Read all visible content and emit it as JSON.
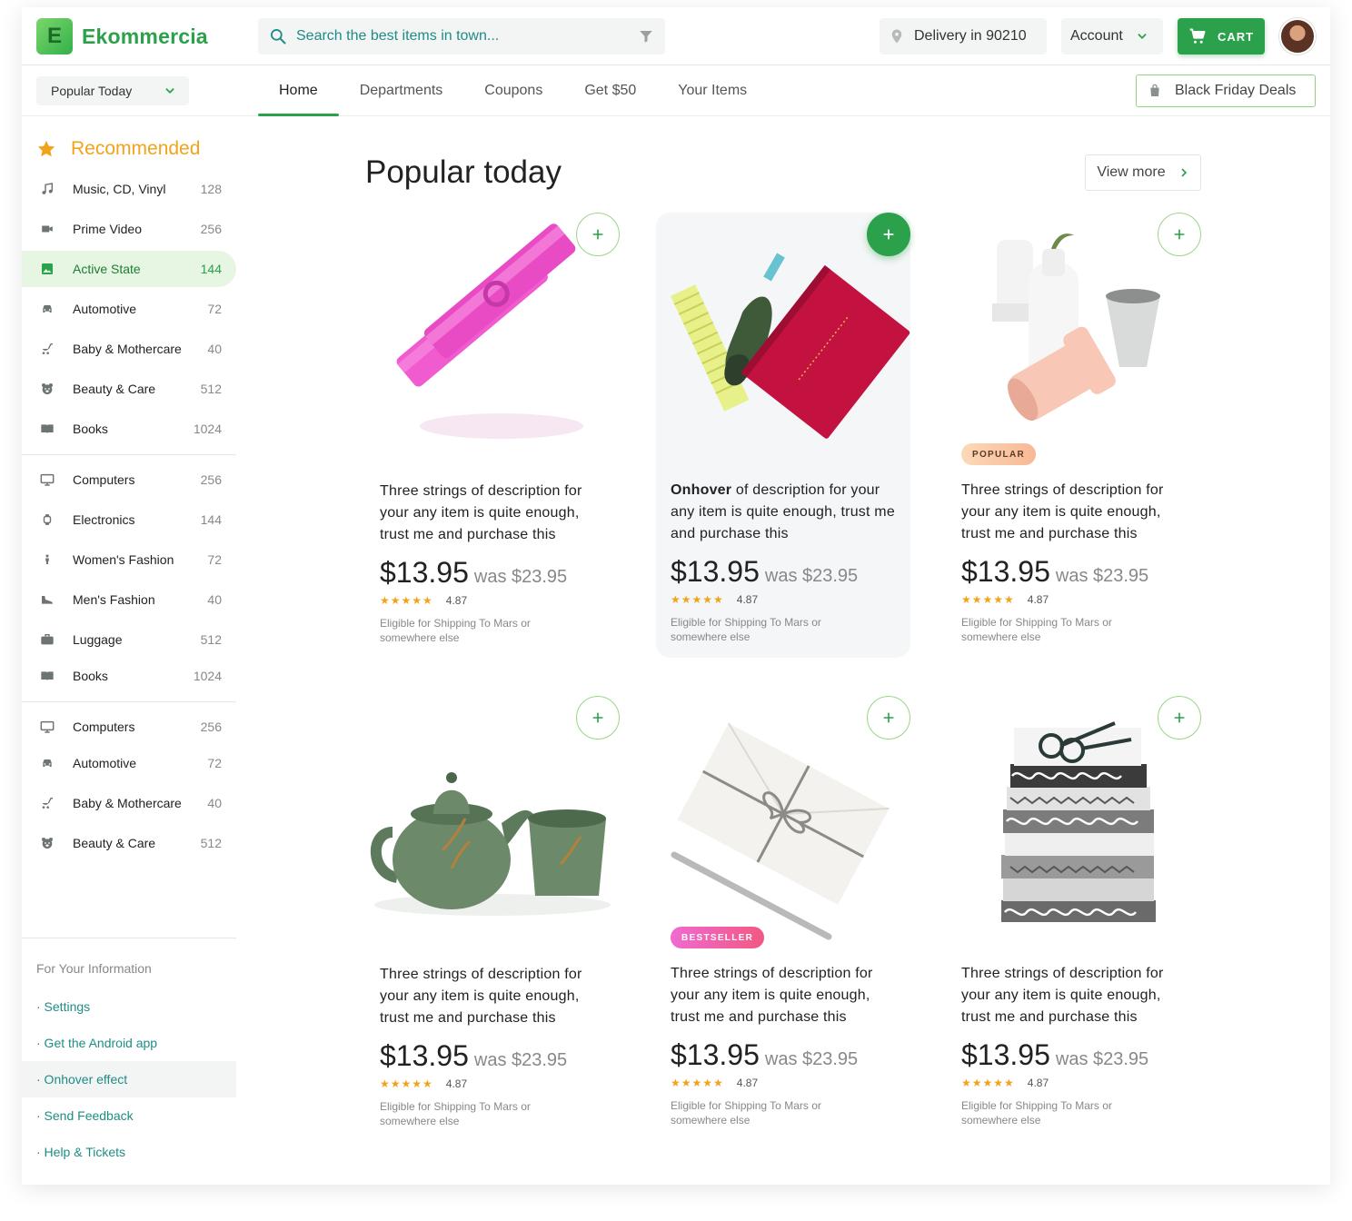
{
  "brand": {
    "initial": "E",
    "name": "Ekommercia"
  },
  "search": {
    "placeholder": "Search the best items in town..."
  },
  "delivery": {
    "label": "Delivery in 90210"
  },
  "account": {
    "label": "Account"
  },
  "cart": {
    "label": "CART"
  },
  "filter_select": {
    "value": "Popular Today"
  },
  "tabs": [
    {
      "label": "Home"
    },
    {
      "label": "Departments"
    },
    {
      "label": "Coupons"
    },
    {
      "label": "Get $50"
    },
    {
      "label": "Your Items"
    }
  ],
  "deals": {
    "label": "Black Friday Deals"
  },
  "sidebar": {
    "recommended_label": "Recommended",
    "categories": [
      {
        "icon": "music-note-icon",
        "label": "Music, CD, Vinyl",
        "count": "128"
      },
      {
        "icon": "video-camera-icon",
        "label": "Prime Video",
        "count": "256"
      },
      {
        "icon": "image-icon",
        "label": "Active State",
        "count": "144"
      },
      {
        "icon": "car-icon",
        "label": "Automotive",
        "count": "72"
      },
      {
        "icon": "stroller-icon",
        "label": "Baby & Mothercare",
        "count": "40"
      },
      {
        "icon": "bear-face-icon",
        "label": "Beauty & Care",
        "count": "512"
      },
      {
        "icon": "book-icon",
        "label": "Books",
        "count": "1024"
      },
      {
        "icon": "monitor-icon",
        "label": "Computers",
        "count": "256"
      },
      {
        "icon": "watch-icon",
        "label": "Electronics",
        "count": "144"
      },
      {
        "icon": "woman-icon",
        "label": "Women's Fashion",
        "count": "72"
      },
      {
        "icon": "shoe-icon",
        "label": "Men's Fashion",
        "count": "40"
      },
      {
        "icon": "briefcase-icon",
        "label": "Luggage",
        "count": "512"
      },
      {
        "icon": "book-icon",
        "label": "Books",
        "count": "1024"
      },
      {
        "icon": "monitor-icon",
        "label": "Computers",
        "count": "256"
      },
      {
        "icon": "car-icon",
        "label": "Automotive",
        "count": "72"
      },
      {
        "icon": "stroller-icon",
        "label": "Baby & Mothercare",
        "count": "40"
      },
      {
        "icon": "bear-face-icon",
        "label": "Beauty & Care",
        "count": "512"
      }
    ],
    "fyi_title": "For Your Information",
    "fyi_links": [
      {
        "label": "· Settings"
      },
      {
        "label": "· Get the Android app"
      },
      {
        "label": "· Onhover effect"
      },
      {
        "label": "· Send Feedback"
      },
      {
        "label": "· Help & Tickets"
      }
    ]
  },
  "main": {
    "title": "Popular today",
    "view_more": "View more",
    "products": [
      {
        "bold": "",
        "desc": "Three strings of description for your any item is quite enough, trust me and purchase this",
        "price": "$13.95",
        "was": "was $23.95",
        "stars": "★★★★★",
        "rating": "4.87",
        "shipping": "Eligible for Shipping To Mars or somewhere else",
        "badge": ""
      },
      {
        "bold": "Onhover",
        "desc": " of description for your any item is quite enough, trust me and purchase this",
        "price": "$13.95",
        "was": "was $23.95",
        "stars": "★★★★★",
        "rating": "4.87",
        "shipping": "Eligible for Shipping To Mars or somewhere else",
        "badge": ""
      },
      {
        "bold": "",
        "desc": "Three strings of description for your any item is quite enough, trust me and purchase this",
        "price": "$13.95",
        "was": "was $23.95",
        "stars": "★★★★★",
        "rating": "4.87",
        "shipping": "Eligible for Shipping To Mars or somewhere else",
        "badge": "POPULAR"
      },
      {
        "bold": "",
        "desc": "Three strings of description for your any item is quite enough, trust me and purchase this",
        "price": "$13.95",
        "was": "was $23.95",
        "stars": "★★★★★",
        "rating": "4.87",
        "shipping": "Eligible for Shipping To Mars or somewhere else",
        "badge": ""
      },
      {
        "bold": "",
        "desc": "Three strings of description for your any item is quite enough, trust me and purchase this",
        "price": "$13.95",
        "was": "was $23.95",
        "stars": "★★★★★",
        "rating": "4.87",
        "shipping": "Eligible for Shipping To Mars or somewhere else",
        "badge": "BESTSELLER"
      },
      {
        "bold": "",
        "desc": "Three strings of description for your any item is quite enough, trust me and purchase this",
        "price": "$13.95",
        "was": "was $23.95",
        "stars": "★★★★★",
        "rating": "4.87",
        "shipping": "Eligible for Shipping To Mars or somewhere else",
        "badge": ""
      }
    ]
  },
  "colors": {
    "accent": "#2aa14a",
    "teal": "#1f8c86",
    "star": "#f0a31b"
  }
}
